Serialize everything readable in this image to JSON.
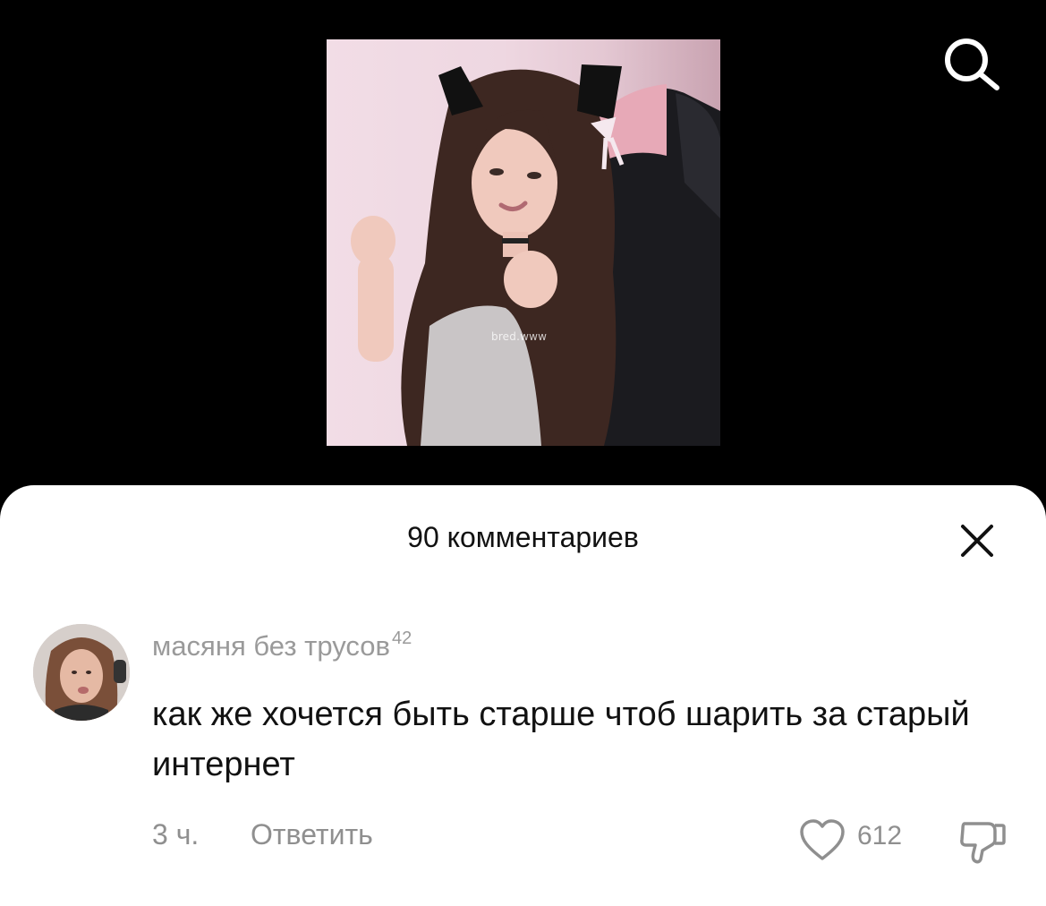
{
  "video": {
    "watermark": "bred.www",
    "search_icon": "search-icon"
  },
  "comments_sheet": {
    "title": "90 комментариев",
    "close_icon": "close-icon",
    "comment": {
      "author": "масяня без трусов",
      "author_badge": "42",
      "text": "как же хочется быть старше чтоб шарить за старый интернет",
      "time": "3 ч.",
      "reply_label": "Ответить",
      "like_icon": "heart-icon",
      "likes": "612",
      "dislike_icon": "thumbs-down-icon"
    }
  },
  "colors": {
    "background": "#000000",
    "sheet": "#ffffff",
    "text_primary": "#111111",
    "text_secondary": "#8f8f8f"
  }
}
